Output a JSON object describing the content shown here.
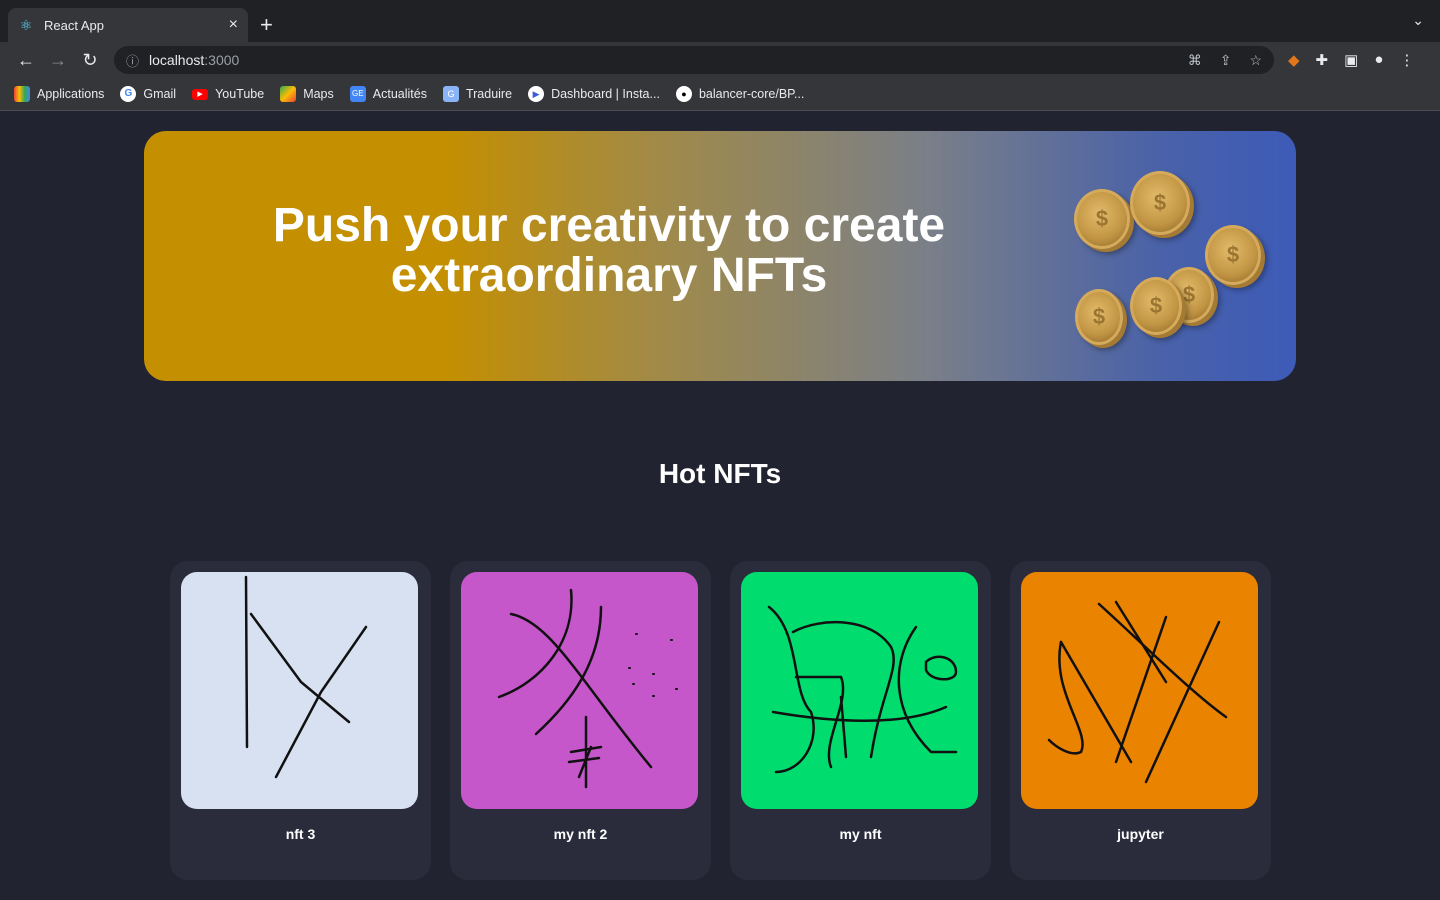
{
  "browser": {
    "tab_title": "React App",
    "url_host": "localhost",
    "url_port": ":3000",
    "bookmarks": [
      "Applications",
      "Gmail",
      "YouTube",
      "Maps",
      "Actualités",
      "Traduire",
      "Dashboard | Insta...",
      "balancer-core/BP..."
    ]
  },
  "hero": {
    "title_line1": "Push your creativity to create",
    "title_line2": "extraordinary NFTs"
  },
  "section": {
    "title": "Hot NFTs"
  },
  "nfts": [
    {
      "name": "nft 3",
      "bg": "#d8e1f2"
    },
    {
      "name": "my nft 2",
      "bg": "#c657cb"
    },
    {
      "name": "my nft",
      "bg": "#00dd6e"
    },
    {
      "name": "jupyter",
      "bg": "#ea8300"
    }
  ]
}
